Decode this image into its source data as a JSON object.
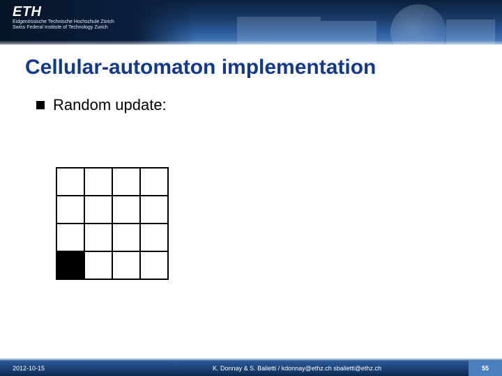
{
  "header": {
    "logo": "ETH",
    "subline1": "Eidgenössische Technische Hochschule Zürich",
    "subline2": "Swiss Federal Institute of Technology Zurich"
  },
  "title": "Cellular-automaton implementation",
  "bullet": {
    "text": "Random update:"
  },
  "grid": {
    "rows": 4,
    "cols": 4,
    "filled": [
      [
        3,
        0
      ]
    ]
  },
  "footer": {
    "date": "2012-10-15",
    "authors": "K. Donnay & S. Balietti / kdonnay@ethz.ch   sbalietti@ethz.ch",
    "page": "55"
  }
}
